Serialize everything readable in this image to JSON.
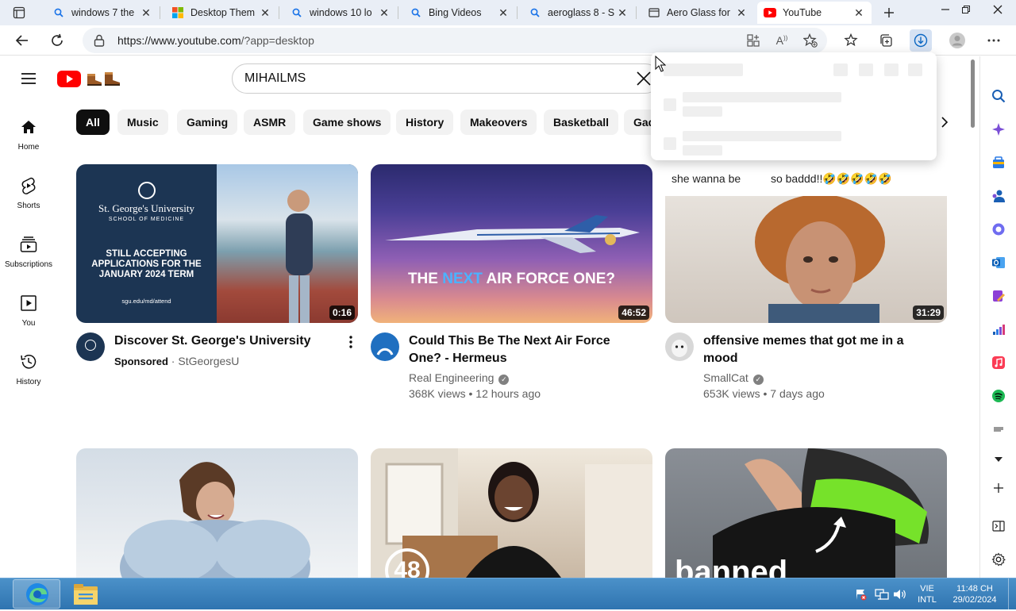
{
  "browser": {
    "tabs": [
      {
        "title": "windows 7 the",
        "icon": "search-icon",
        "active": false
      },
      {
        "title": "Desktop Them",
        "icon": "microsoft-logo-icon",
        "active": false
      },
      {
        "title": "windows 10 lo",
        "icon": "search-icon",
        "active": false
      },
      {
        "title": "Bing Videos",
        "icon": "search-icon",
        "active": false
      },
      {
        "title": "aeroglass 8 - S",
        "icon": "search-icon",
        "active": false
      },
      {
        "title": "Aero Glass for",
        "icon": "page-icon",
        "active": false
      },
      {
        "title": "YouTube",
        "icon": "youtube-icon",
        "active": true
      }
    ],
    "url_host": "https://www.youtube.com",
    "url_path": "/?app=desktop"
  },
  "youtube": {
    "search_value": "MIHAILMS",
    "chips": [
      "All",
      "Music",
      "Gaming",
      "ASMR",
      "Game shows",
      "History",
      "Makeovers",
      "Basketball",
      "Gad"
    ],
    "guide": [
      {
        "label": "Home",
        "icon": "home-icon"
      },
      {
        "label": "Shorts",
        "icon": "shorts-icon"
      },
      {
        "label": "Subscriptions",
        "icon": "subscriptions-icon"
      },
      {
        "label": "You",
        "icon": "you-icon"
      },
      {
        "label": "History",
        "icon": "history-icon"
      }
    ],
    "videos": [
      {
        "title": "Discover St. George's University",
        "channel": "StGeorgesU",
        "sponsored": "Sponsored",
        "duration": "0:16",
        "thumb_text": [
          "St. George's University",
          "SCHOOL OF MEDICINE",
          "STILL ACCEPTING APPLICATIONS FOR THE JANUARY 2024 TERM",
          "sgu.edu/md/attend"
        ]
      },
      {
        "title": "Could This Be The Next Air Force One? - Hermeus",
        "channel": "Real Engineering",
        "views": "368K views",
        "age": "12 hours ago",
        "duration": "46:52",
        "thumb_text": [
          "THE",
          "NEXT",
          "AIR FORCE ONE?"
        ]
      },
      {
        "title": "offensive memes that got me in a mood",
        "channel": "SmallCat",
        "views": "653K views",
        "age": "7 days ago",
        "duration": "31:29",
        "thumb_text": [
          "she wanna be",
          "so baddd!!🤣🤣🤣🤣🤣"
        ]
      }
    ],
    "row2_thumb_text": [
      "48",
      "banned"
    ]
  },
  "taskbar": {
    "lang_top": "VIE",
    "lang_bottom": "INTL",
    "time": "11:48 CH",
    "date": "29/02/2024"
  },
  "colors": {
    "youtube_red": "#ff0000",
    "edge_accent": "#0a66c2",
    "taskbar": "#2f74b0"
  }
}
